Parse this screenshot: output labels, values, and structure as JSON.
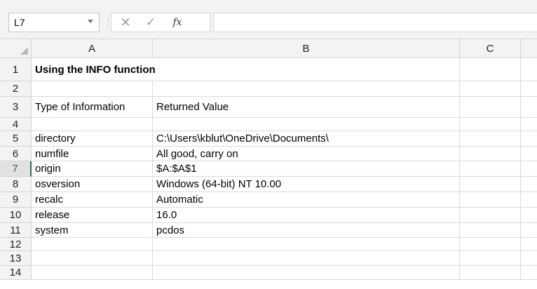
{
  "name_box": {
    "value": "L7"
  },
  "formula_bar": {
    "cancel_glyph": "✕",
    "enter_glyph": "✓",
    "fx_label": "fx",
    "value": ""
  },
  "columns": [
    "A",
    "B",
    "C"
  ],
  "rows": [
    {
      "num": "1",
      "a": "Using the INFO function",
      "b": ""
    },
    {
      "num": "2",
      "a": "",
      "b": ""
    },
    {
      "num": "3",
      "a": "Type of Information",
      "b": "Returned Value"
    },
    {
      "num": "4",
      "a": "",
      "b": ""
    },
    {
      "num": "5",
      "a": "directory",
      "b": "C:\\Users\\kblut\\OneDrive\\Documents\\"
    },
    {
      "num": "6",
      "a": "numfile",
      "b": "All good, carry on"
    },
    {
      "num": "7",
      "a": "origin",
      "b": "$A:$A$1"
    },
    {
      "num": "8",
      "a": "osversion",
      "b": "Windows (64-bit) NT 10.00"
    },
    {
      "num": "9",
      "a": "recalc",
      "b": "Automatic"
    },
    {
      "num": "10",
      "a": "release",
      "b": "16.0"
    },
    {
      "num": "11",
      "a": "system",
      "b": "pcdos"
    },
    {
      "num": "12",
      "a": "",
      "b": ""
    },
    {
      "num": "13",
      "a": "",
      "b": ""
    },
    {
      "num": "14",
      "a": "",
      "b": ""
    }
  ],
  "colors": {
    "selected_row_header": "#217346",
    "header_bg": "#f3f3f3",
    "gridline": "#dadada"
  }
}
